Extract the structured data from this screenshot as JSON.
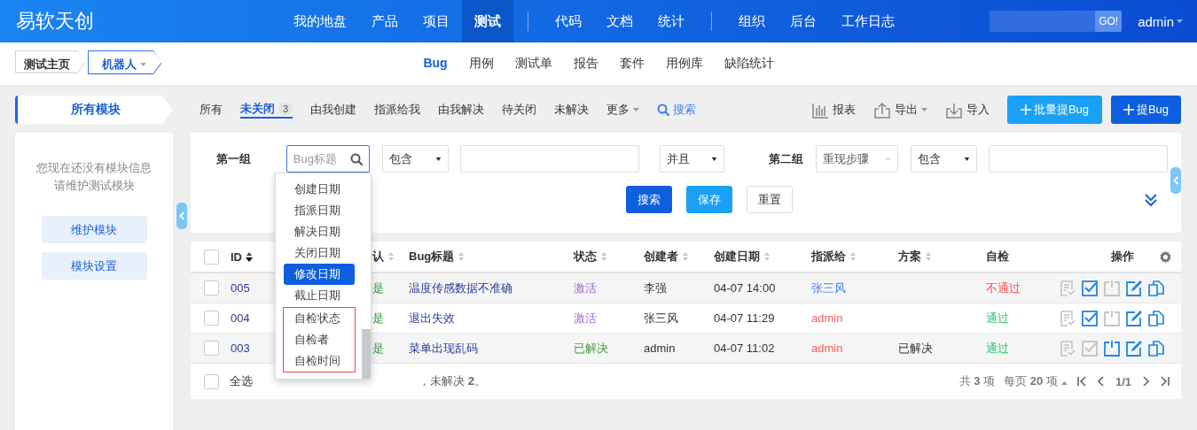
{
  "header": {
    "logo": "易软天创",
    "nav_groups": [
      [
        {
          "label": "我的地盘",
          "selected": false
        },
        {
          "label": "产品",
          "selected": false
        },
        {
          "label": "项目",
          "selected": false
        },
        {
          "label": "测试",
          "selected": true
        }
      ],
      [
        {
          "label": "代码",
          "selected": false
        },
        {
          "label": "文档",
          "selected": false
        },
        {
          "label": "统计",
          "selected": false
        }
      ],
      [
        {
          "label": "组织",
          "selected": false
        },
        {
          "label": "后台",
          "selected": false
        },
        {
          "label": "工作日志",
          "selected": false
        }
      ]
    ],
    "search_button": "GO!",
    "user": "admin"
  },
  "breadcrumb": [
    {
      "label": "测试主页",
      "selected": false
    },
    {
      "label": "机器人",
      "selected": true
    }
  ],
  "subnav": [
    {
      "label": "Bug",
      "selected": true
    },
    {
      "label": "用例",
      "selected": false
    },
    {
      "label": "测试单",
      "selected": false
    },
    {
      "label": "报告",
      "selected": false
    },
    {
      "label": "套件",
      "selected": false
    },
    {
      "label": "用例库",
      "selected": false
    },
    {
      "label": "缺陷统计",
      "selected": false
    }
  ],
  "sidebar": {
    "title": "所有模块",
    "message": [
      "您现在还没有模块信息",
      "请维护测试模块"
    ],
    "buttons": [
      "维护模块",
      "模块设置"
    ]
  },
  "filter_tabs": [
    {
      "label": "所有",
      "selected": false
    },
    {
      "label": "未关闭",
      "selected": true,
      "count": "3"
    },
    {
      "label": "由我创建",
      "selected": false
    },
    {
      "label": "指派给我",
      "selected": false
    },
    {
      "label": "由我解决",
      "selected": false
    },
    {
      "label": "待关闭",
      "selected": false
    },
    {
      "label": "未解决",
      "selected": false
    },
    {
      "label": "更多",
      "selected": false,
      "kind": "menu"
    },
    {
      "label": "搜索",
      "selected": false,
      "kind": "search"
    }
  ],
  "toolbar": [
    {
      "label": "报表",
      "kind": "report"
    },
    {
      "label": "导出",
      "kind": "export"
    },
    {
      "label": "导入",
      "kind": "import"
    }
  ],
  "action_buttons": [
    {
      "label": "批量提Bug",
      "kind": "secondary"
    },
    {
      "label": "提Bug",
      "kind": "primary"
    }
  ],
  "search_form": {
    "groups": [
      {
        "label": "第一组",
        "field": {
          "placeholder": "Bug标题",
          "open": true
        },
        "operator": "包含"
      },
      {
        "label": "第二组",
        "field": {
          "value": "重现步骤",
          "open": false
        },
        "operator": "包含"
      }
    ],
    "join": "并且",
    "buttons": [
      {
        "label": "搜索",
        "kind": "primary"
      },
      {
        "label": "保存",
        "kind": "secondary"
      },
      {
        "label": "重置",
        "kind": "plain"
      }
    ],
    "field_menu": [
      {
        "label": "创建日期",
        "selected": false,
        "highlighted": false
      },
      {
        "label": "指派日期",
        "selected": false,
        "highlighted": false
      },
      {
        "label": "解决日期",
        "selected": false,
        "highlighted": false
      },
      {
        "label": "关闭日期",
        "selected": false,
        "highlighted": false
      },
      {
        "label": "修改日期",
        "selected": true,
        "highlighted": false
      },
      {
        "label": "截止日期",
        "selected": false,
        "highlighted": false
      },
      {
        "label": "自检状态",
        "selected": false,
        "highlighted": true
      },
      {
        "label": "自检者",
        "selected": false,
        "highlighted": true
      },
      {
        "label": "自检时间",
        "selected": false,
        "highlighted": true
      }
    ]
  },
  "table": {
    "header_checked": false,
    "columns": [
      {
        "label": "ID",
        "sortable": true,
        "sorted": true
      },
      {
        "label": "认",
        "sortable": true,
        "sorted": false
      },
      {
        "label": "Bug标题",
        "sortable": true,
        "sorted": false
      },
      {
        "label": "状态",
        "sortable": true,
        "sorted": false
      },
      {
        "label": "创建者",
        "sortable": true,
        "sorted": false
      },
      {
        "label": "创建日期",
        "sortable": true,
        "sorted": false
      },
      {
        "label": "指派给",
        "sortable": true,
        "sorted": false
      },
      {
        "label": "方案",
        "sortable": true,
        "sorted": false
      },
      {
        "label": "自检",
        "sortable": false
      },
      {
        "label": "操作",
        "sortable": false
      }
    ],
    "rows": [
      {
        "checked": false,
        "id": "005",
        "confirmed": "是",
        "title": "温度传感数据不准确",
        "status": {
          "text": "激活",
          "color": "#9a6fd0"
        },
        "creator": "李强",
        "date": "04-07 14:00",
        "assignee": {
          "text": "张三风",
          "color": "#3f7ff0"
        },
        "resolution": "",
        "self_check": {
          "text": "不通过",
          "color": "#ff4d4f"
        },
        "actions": [
          {
            "kind": "confirm",
            "enabled": false
          },
          {
            "kind": "resolve",
            "enabled": true
          },
          {
            "kind": "close",
            "enabled": false
          },
          {
            "kind": "edit",
            "enabled": true
          },
          {
            "kind": "copy",
            "enabled": true
          }
        ]
      },
      {
        "checked": false,
        "id": "004",
        "confirmed": "是",
        "title": "退出失效",
        "status": {
          "text": "激活",
          "color": "#9a6fd0"
        },
        "creator": "张三风",
        "date": "04-07 11:29",
        "assignee": {
          "text": "admin",
          "color": "#ff5a5a"
        },
        "resolution": "",
        "self_check": {
          "text": "通过",
          "color": "#2bc46d"
        },
        "actions": [
          {
            "kind": "confirm",
            "enabled": false
          },
          {
            "kind": "resolve",
            "enabled": true
          },
          {
            "kind": "close",
            "enabled": false
          },
          {
            "kind": "edit",
            "enabled": true
          },
          {
            "kind": "copy",
            "enabled": true
          }
        ]
      },
      {
        "checked": false,
        "id": "003",
        "confirmed": "是",
        "title": "菜单出现乱码",
        "status": {
          "text": "已解决",
          "color": "#43a047"
        },
        "creator": "admin",
        "date": "04-07 11:02",
        "assignee": {
          "text": "admin",
          "color": "#ff5a5a"
        },
        "resolution": "已解决",
        "self_check": {
          "text": "通过",
          "color": "#2bc46d"
        },
        "actions": [
          {
            "kind": "confirm",
            "enabled": false
          },
          {
            "kind": "resolve",
            "enabled": false
          },
          {
            "kind": "close",
            "enabled": true
          },
          {
            "kind": "edit",
            "enabled": true
          },
          {
            "kind": "copy",
            "enabled": true
          }
        ]
      }
    ],
    "footer": {
      "select_all": "全选",
      "select_all_checked": false,
      "summary": "，未解决 **2**。",
      "total": "共 **3** 项",
      "per_page": "每页 **20** 项",
      "page": "1/1"
    }
  }
}
